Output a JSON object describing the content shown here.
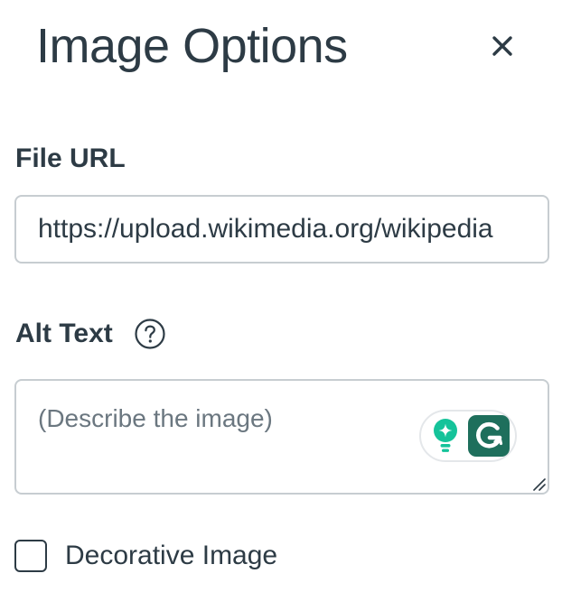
{
  "panel": {
    "title": "Image Options",
    "close_label": "Close"
  },
  "file_url": {
    "label": "File URL",
    "value": "https://upload.wikimedia.org/wikipedia"
  },
  "alt_text": {
    "label": "Alt Text",
    "help_icon": "question-circle-icon",
    "value": "",
    "placeholder": "(Describe the image)"
  },
  "grammarly": {
    "assist_icon": "lightbulb-sparkle-icon",
    "logo_icon": "grammarly-logo-icon",
    "colors": {
      "teal": "#15c39a",
      "dark_teal": "#1e6f5c"
    }
  },
  "decorative": {
    "label": "Decorative Image",
    "checked": false
  },
  "colors": {
    "text": "#2d3b45",
    "border": "#c7cdd1",
    "placeholder": "#6b7780"
  }
}
